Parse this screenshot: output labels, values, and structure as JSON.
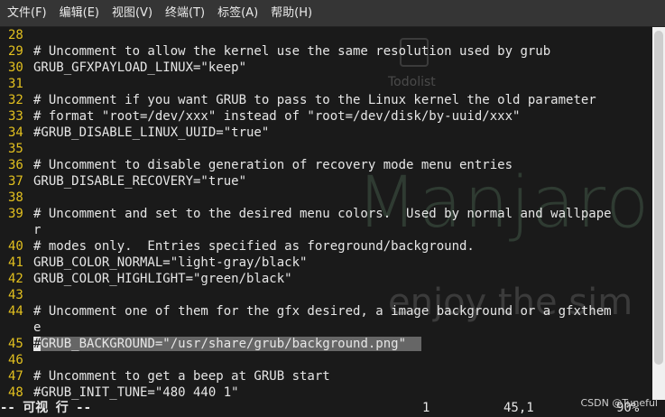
{
  "menu": [
    "文件(F)",
    "编辑(E)",
    "视图(V)",
    "终端(T)",
    "标签(A)",
    "帮助(H)"
  ],
  "wallpaper": {
    "todolist": "Todolist",
    "manjaro": "Manjaro Linux",
    "enjoy": "enjoy the sim"
  },
  "lines": [
    {
      "n": "28",
      "t": ""
    },
    {
      "n": "29",
      "t": "# Uncomment to allow the kernel use the same resolution used by grub"
    },
    {
      "n": "30",
      "t": "GRUB_GFXPAYLOAD_LINUX=\"keep\""
    },
    {
      "n": "31",
      "t": ""
    },
    {
      "n": "32",
      "t": "# Uncomment if you want GRUB to pass to the Linux kernel the old parameter"
    },
    {
      "n": "33",
      "t": "# format \"root=/dev/xxx\" instead of \"root=/dev/disk/by-uuid/xxx\""
    },
    {
      "n": "34",
      "t": "#GRUB_DISABLE_LINUX_UUID=\"true\""
    },
    {
      "n": "35",
      "t": ""
    },
    {
      "n": "36",
      "t": "# Uncomment to disable generation of recovery mode menu entries"
    },
    {
      "n": "37",
      "t": "GRUB_DISABLE_RECOVERY=\"true\""
    },
    {
      "n": "38",
      "t": ""
    },
    {
      "n": "39",
      "t": "# Uncomment and set to the desired menu colors.  Used by normal and wallpape"
    },
    {
      "n": "",
      "t": "r"
    },
    {
      "n": "40",
      "t": "# modes only.  Entries specified as foreground/background."
    },
    {
      "n": "41",
      "t": "GRUB_COLOR_NORMAL=\"light-gray/black\""
    },
    {
      "n": "42",
      "t": "GRUB_COLOR_HIGHLIGHT=\"green/black\""
    },
    {
      "n": "43",
      "t": ""
    },
    {
      "n": "44",
      "t": "# Uncomment one of them for the gfx desired, a image background or a gfxthem"
    },
    {
      "n": "",
      "t": "e"
    },
    {
      "n": "45",
      "t": "#GRUB_BACKGROUND=\"/usr/share/grub/background.png\"",
      "highlight": true,
      "cursor": 0
    },
    {
      "n": "46",
      "t": ""
    },
    {
      "n": "47",
      "t": "# Uncomment to get a beep at GRUB start"
    },
    {
      "n": "48",
      "t": "#GRUB_INIT_TUNE=\"480 440 1\""
    }
  ],
  "status": {
    "mode": "-- 可视 行 --",
    "count": "1",
    "position": "45,1",
    "percent": "90%"
  },
  "watermark": "CSDN @Tuneful"
}
